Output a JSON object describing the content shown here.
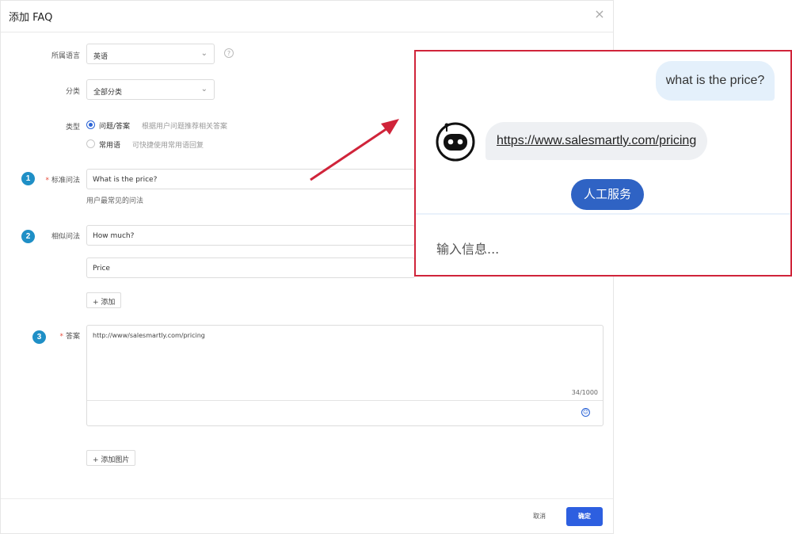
{
  "dialog": {
    "title": "添加 FAQ",
    "close_icon": "×"
  },
  "form": {
    "language": {
      "label": "所属语言",
      "value": "英语",
      "chevron": "⌄",
      "help_icon": "?"
    },
    "category": {
      "label": "分类",
      "value": "全部分类",
      "chevron": "⌄"
    },
    "type": {
      "label": "类型",
      "options": [
        {
          "label": "问题/答案",
          "desc": "根据用户问题推荐相关答案",
          "selected": true
        },
        {
          "label": "常用语",
          "desc": "可快捷使用常用语回复",
          "selected": false
        }
      ]
    },
    "standard_question": {
      "step": "1",
      "required_mark": "*",
      "label": "标准问法",
      "value": "What is the price?",
      "hint": "用户最常见的问法"
    },
    "similar_questions": {
      "step": "2",
      "label": "相似问法",
      "values": [
        "How much?",
        "Price"
      ],
      "add_label": "+ 添加"
    },
    "answer": {
      "step": "3",
      "required_mark": "*",
      "label": "答案",
      "value": "http://www/salesmartly.com/pricing",
      "counter": "34/1000",
      "emoji_icon": "☺",
      "add_image_label": "+ 添加图片"
    }
  },
  "footer": {
    "cancel_label": "取消",
    "ok_label": "确定"
  },
  "chat_preview": {
    "user_message": "what is the price?",
    "bot_message": "https://www.salesmartly.com/pricing",
    "human_service_label": "人工服务",
    "input_placeholder": "输入信息..."
  },
  "colors": {
    "primary": "#2d5fe0",
    "step_badge": "#1f8fc6",
    "highlight_border": "#d0243a",
    "arrow": "#d0243a"
  }
}
